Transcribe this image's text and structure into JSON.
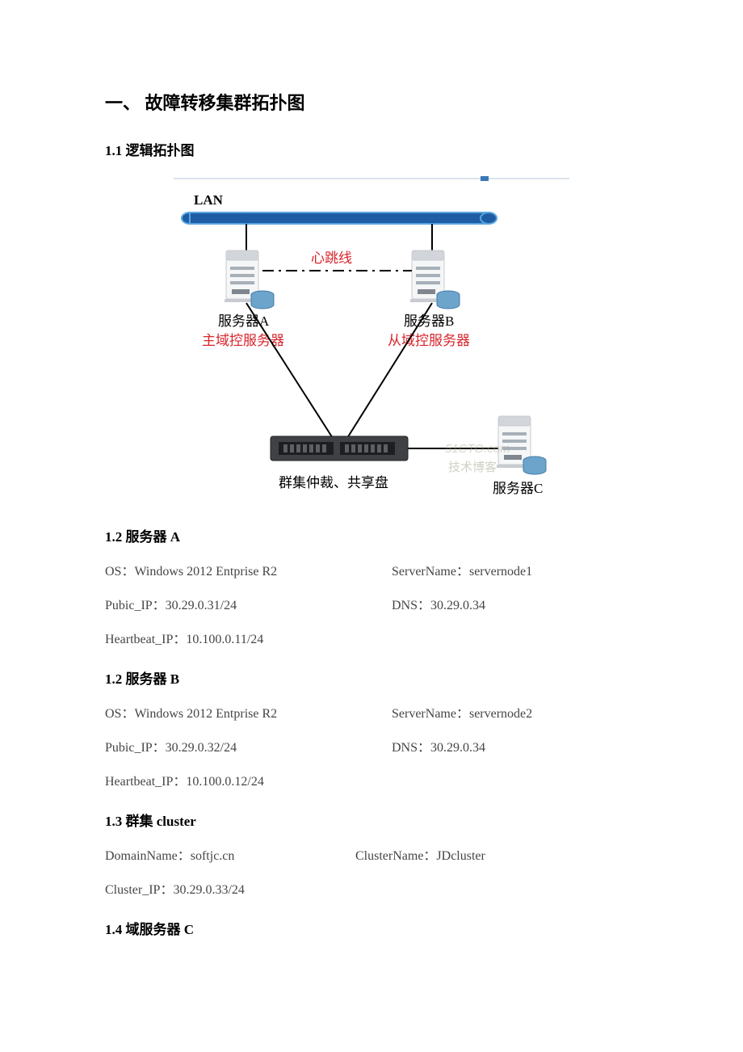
{
  "h1": "一、  故障转移集群拓扑图",
  "sec11": "1.1 逻辑拓扑图",
  "diagram": {
    "lan": "LAN",
    "heartbeat": "心跳线",
    "serverA": "服务器A",
    "serverA_role": "主域控服务器",
    "serverB": "服务器B",
    "serverB_role": "从域控服务器",
    "quorum": "群集仲裁、共享盘",
    "serverC": "服务器C",
    "watermark1": "51CTO.com",
    "watermark2": "技术博客"
  },
  "sec12a": "1.2 服务器 A",
  "servA": {
    "os": "OS：Windows 2012 Entprise R2",
    "name": "ServerName：servernode1",
    "pub": "Pubic_IP：30.29.0.31/24",
    "dns": "DNS：30.29.0.34",
    "hb": "Heartbeat_IP：10.100.0.11/24"
  },
  "sec12b": "1.2 服务器 B",
  "servB": {
    "os": "OS：Windows 2012 Entprise R2",
    "name": "ServerName：servernode2",
    "pub": "Pubic_IP：30.29.0.32/24",
    "dns": "DNS：30.29.0.34",
    "hb": "Heartbeat_IP：10.100.0.12/24"
  },
  "sec13": "1.3 群集 cluster",
  "cluster": {
    "domain": "DomainName：softjc.cn",
    "cname": "ClusterName：JDcluster",
    "cip": "Cluster_IP：30.29.0.33/24"
  },
  "sec14": "1.4  域服务器 C"
}
